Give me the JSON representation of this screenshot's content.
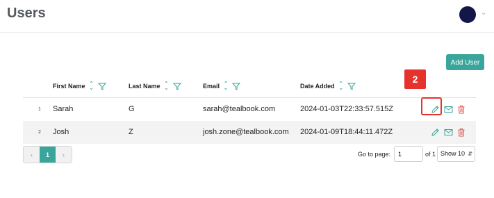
{
  "header": {
    "title": "Users",
    "avatar_color": "#14164a"
  },
  "toolbar": {
    "add_user_label": "Add User"
  },
  "table": {
    "columns": [
      "First Name",
      "Last Name",
      "Email",
      "Date Added"
    ],
    "rows": [
      {
        "index": "1",
        "first_name": "Sarah",
        "last_name": "G",
        "email": "sarah@tealbook.com",
        "date_added": "2024-01-03T22:33:57.515Z"
      },
      {
        "index": "2",
        "first_name": "Josh",
        "last_name": "Z",
        "email": "josh.zone@tealbook.com",
        "date_added": "2024-01-09T18:44:11.472Z"
      }
    ]
  },
  "annotation": {
    "step": "2"
  },
  "pagination": {
    "prev": "‹",
    "current_page": "1",
    "next": "›",
    "goto_label": "Go to page:",
    "goto_value": "1",
    "of_label": "of 1",
    "show_label": "Show 10"
  },
  "colors": {
    "accent": "#3aa59a",
    "danger": "#d9534f",
    "highlight": "#e5322d"
  },
  "icons": [
    "sort-icon",
    "filter-icon",
    "pencil-icon",
    "mail-icon",
    "trash-icon",
    "chevron-down-icon"
  ]
}
